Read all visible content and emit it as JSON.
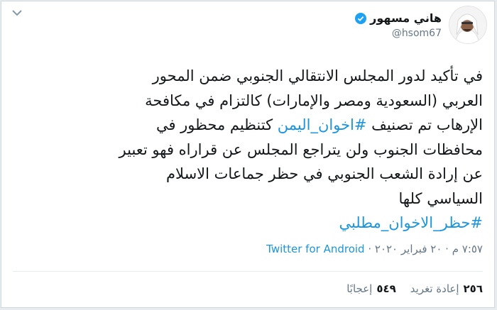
{
  "tweet": {
    "author_name": "هاني مسهور",
    "handle": "@hsom67",
    "verified": true,
    "text_lines": [
      [
        "في تأكيد لدور المجلس الانتقالي الجنوبي ضمن المحور"
      ],
      [
        "العربي (السعودية ومصر والإمارات) كالتزام في مكافحة"
      ],
      [
        "الإرهاب تم تصنيف ",
        "#اخوان_اليمن",
        " كتنظيم محظور في"
      ],
      [
        "محافظات الجنوب ولن يتراجع المجلس عن قراراه فهو تعبير"
      ],
      [
        "عن إرادة الشعب الجنوبي في حظر جماعات الاسلام"
      ],
      [
        "السياسي كلها"
      ],
      [
        "#حظر_الاخوان_مطلبي"
      ]
    ],
    "time": "٧:٥٧ م",
    "date": "٢٠ فبراير ٢٠٢٠",
    "separator": " · ",
    "source": "Twitter for Android",
    "retweet_count": "٢٥٦",
    "retweet_label": "إعادة تغريد",
    "like_count": "٥٤٩",
    "like_label": "إعجابًا"
  },
  "colors": {
    "link": "#1b95e0",
    "text": "#14171a",
    "secondary": "#657786",
    "verified": "#1da1f2"
  },
  "icons": {
    "verified": "verified-badge-icon",
    "chevron": "chevron-down-icon"
  }
}
